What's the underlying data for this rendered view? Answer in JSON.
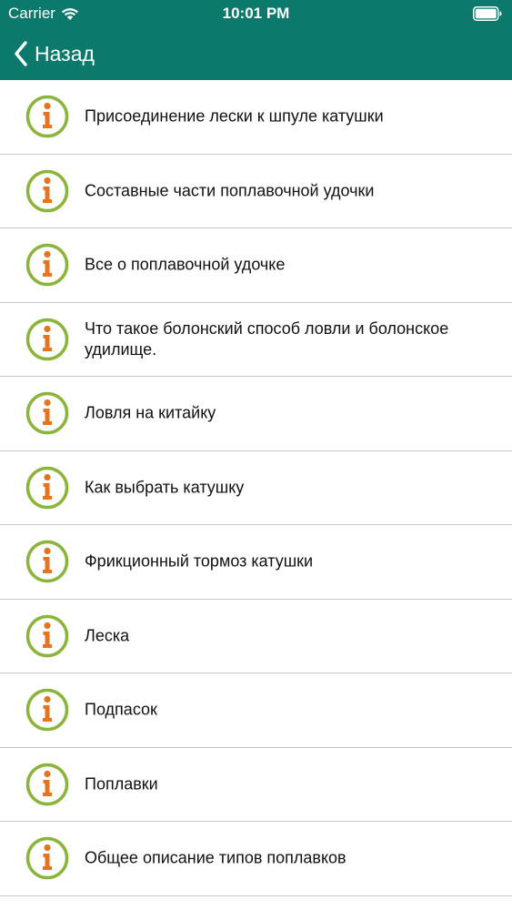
{
  "status_bar": {
    "carrier": "Carrier",
    "time": "10:01 PM",
    "wifi_icon": "wifi-icon",
    "battery_icon": "battery-icon"
  },
  "nav": {
    "back_label": "Назад",
    "back_icon": "chevron-left-icon"
  },
  "colors": {
    "nav_background": "#0b7a6c",
    "icon_ring": "#8ab43a",
    "icon_glyph": "#e8731e"
  },
  "list": {
    "icon": "info-icon",
    "items": [
      {
        "label": "Присоединение лески к шпуле катушки"
      },
      {
        "label": "Составные части поплавочной удочки"
      },
      {
        "label": "Все о поплавочной удочке"
      },
      {
        "label": "Что такое болонский способ ловли и болонское удилище."
      },
      {
        "label": "Ловля на китайку"
      },
      {
        "label": "Как выбрать катушку"
      },
      {
        "label": "Фрикционный тормоз катушки"
      },
      {
        "label": "Леска"
      },
      {
        "label": "Подпасок"
      },
      {
        "label": "Поплавки"
      },
      {
        "label": "Общее описание типов поплавков"
      }
    ]
  }
}
